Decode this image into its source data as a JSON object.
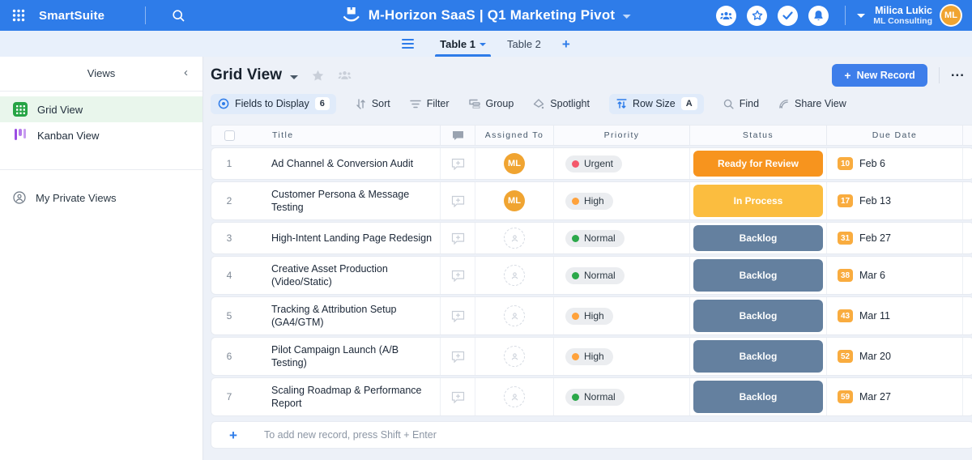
{
  "header": {
    "app_name": "SmartSuite",
    "doc_title": "M-Horizon SaaS | Q1 Marketing Pivot",
    "user_name": "Milica Lukic",
    "user_org": "ML Consulting",
    "avatar_initials": "ML"
  },
  "tabs": {
    "table1": "Table 1",
    "table2": "Table 2",
    "add": "+"
  },
  "sidebar": {
    "heading": "Views",
    "grid_view": "Grid View",
    "kanban_view": "Kanban View",
    "private_views": "My Private Views"
  },
  "toolbar": {
    "view_title": "Grid View",
    "fields_to_display": "Fields to Display",
    "fields_count": "6",
    "sort": "Sort",
    "filter": "Filter",
    "group": "Group",
    "spotlight": "Spotlight",
    "row_size": "Row Size",
    "row_size_value": "A",
    "find": "Find",
    "share_view": "Share View",
    "new_record": "New Record",
    "more": "..."
  },
  "table": {
    "headers": {
      "title": "Title",
      "assigned_to": "Assigned To",
      "priority": "Priority",
      "status": "Status",
      "due_date": "Due Date"
    },
    "add_record_hint": "To add new record, press Shift + Enter",
    "rows": [
      {
        "num": "1",
        "title": "Ad Channel & Conversion Audit",
        "assignee": "ML",
        "priority": "Urgent",
        "priority_color": "#F4586B",
        "status": "Ready for Review",
        "status_color": "#F7941E",
        "due_days": "10",
        "due_date": "Feb 6"
      },
      {
        "num": "2",
        "title": "Customer Persona & Message Testing",
        "assignee": "ML",
        "priority": "High",
        "priority_color": "#FFA23B",
        "status": "In Process",
        "status_color": "#FBBD3F",
        "due_days": "17",
        "due_date": "Feb 13"
      },
      {
        "num": "3",
        "title": "High-Intent Landing Page Redesign",
        "assignee": "",
        "priority": "Normal",
        "priority_color": "#2BA84A",
        "status": "Backlog",
        "status_color": "#64809F",
        "due_days": "31",
        "due_date": "Feb 27"
      },
      {
        "num": "4",
        "title": "Creative Asset Production (Video/Static)",
        "assignee": "",
        "priority": "Normal",
        "priority_color": "#2BA84A",
        "status": "Backlog",
        "status_color": "#64809F",
        "due_days": "38",
        "due_date": "Mar 6"
      },
      {
        "num": "5",
        "title": "Tracking & Attribution Setup (GA4/GTM)",
        "assignee": "",
        "priority": "High",
        "priority_color": "#FFA23B",
        "status": "Backlog",
        "status_color": "#64809F",
        "due_days": "43",
        "due_date": "Mar 11"
      },
      {
        "num": "6",
        "title": "Pilot Campaign Launch (A/B Testing)",
        "assignee": "",
        "priority": "High",
        "priority_color": "#FFA23B",
        "status": "Backlog",
        "status_color": "#64809F",
        "due_days": "52",
        "due_date": "Mar 20"
      },
      {
        "num": "7",
        "title": "Scaling Roadmap & Performance Report",
        "assignee": "",
        "priority": "Normal",
        "priority_color": "#2BA84A",
        "status": "Backlog",
        "status_color": "#64809F",
        "due_days": "59",
        "due_date": "Mar 27"
      }
    ]
  },
  "colors": {
    "header_blue": "#2E7CE9",
    "avatar_orange": "#F0A431",
    "due_badge": "#F9AC3F",
    "grid_view_green": "#26A445",
    "kanban_purple": "#9B4DE3"
  }
}
